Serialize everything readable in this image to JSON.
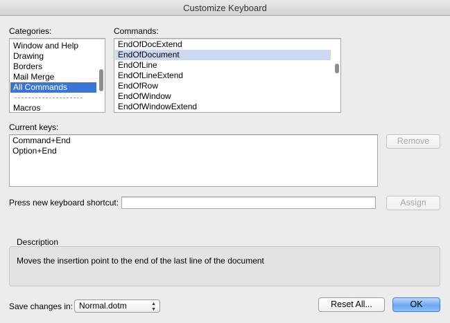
{
  "window": {
    "title": "Customize Keyboard"
  },
  "categories": {
    "label": "Categories:",
    "items": [
      {
        "label": "Window and Help",
        "state": "normal"
      },
      {
        "label": "Drawing",
        "state": "normal"
      },
      {
        "label": "Borders",
        "state": "normal"
      },
      {
        "label": "Mail Merge",
        "state": "normal"
      },
      {
        "label": "All Commands",
        "state": "selected"
      },
      {
        "label": "----------------------",
        "state": "separator"
      },
      {
        "label": "Macros",
        "state": "normal"
      }
    ]
  },
  "commands": {
    "label": "Commands:",
    "items": [
      {
        "label": "EndOfDocExtend",
        "state": "normal"
      },
      {
        "label": "EndOfDocument",
        "state": "selected"
      },
      {
        "label": "EndOfLine",
        "state": "normal"
      },
      {
        "label": "EndOfLineExtend",
        "state": "normal"
      },
      {
        "label": "EndOfRow",
        "state": "normal"
      },
      {
        "label": "EndOfWindow",
        "state": "normal"
      },
      {
        "label": "EndOfWindowExtend",
        "state": "normal"
      }
    ]
  },
  "current_keys": {
    "label": "Current keys:",
    "items": [
      "Command+End",
      "Option+End"
    ],
    "remove_label": "Remove"
  },
  "shortcut": {
    "label": "Press new keyboard shortcut:",
    "value": "",
    "assign_label": "Assign"
  },
  "description": {
    "label": "Description",
    "text": "Moves the insertion point to the end of the last line of the document"
  },
  "footer": {
    "save_label": "Save changes in:",
    "save_value": "Normal.dotm",
    "reset_label": "Reset All...",
    "ok_label": "OK"
  }
}
